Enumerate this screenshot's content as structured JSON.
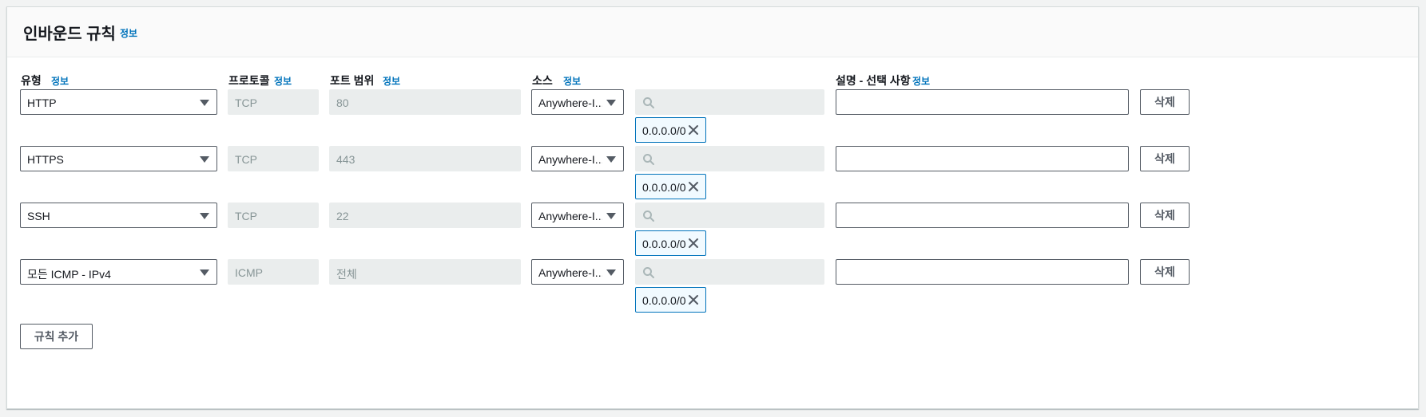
{
  "section": {
    "title": "인바운드 규칙",
    "info_label": "정보"
  },
  "columns": {
    "type": "유형",
    "protocol": "프로토콜",
    "port_range": "포트 범위",
    "source": "소스",
    "description": "설명 - 선택 사항",
    "info_label": "정보"
  },
  "rules": [
    {
      "type": "HTTP",
      "protocol": "TCP",
      "port_range": "80",
      "source_type": "Anywhere-I...",
      "source_search_value": "",
      "cidr": "0.0.0.0/0",
      "description": "",
      "delete_label": "삭제"
    },
    {
      "type": "HTTPS",
      "protocol": "TCP",
      "port_range": "443",
      "source_type": "Anywhere-I...",
      "source_search_value": "",
      "cidr": "0.0.0.0/0",
      "description": "",
      "delete_label": "삭제"
    },
    {
      "type": "SSH",
      "protocol": "TCP",
      "port_range": "22",
      "source_type": "Anywhere-I...",
      "source_search_value": "",
      "cidr": "0.0.0.0/0",
      "description": "",
      "delete_label": "삭제"
    },
    {
      "type": "모든 ICMP - IPv4",
      "protocol": "ICMP",
      "port_range": "전체",
      "source_type": "Anywhere-I...",
      "source_search_value": "",
      "cidr": "0.0.0.0/0",
      "description": "",
      "delete_label": "삭제"
    }
  ],
  "add_rule_label": "규칙 추가",
  "icons": {
    "dropdown": "caret-down-icon",
    "search": "search-icon",
    "remove": "close-icon"
  },
  "colors": {
    "link": "#0073bb",
    "chip_border": "#0073bb",
    "chip_bg": "#f1faff",
    "readonly_bg": "#eaeded",
    "border": "#545b64"
  }
}
